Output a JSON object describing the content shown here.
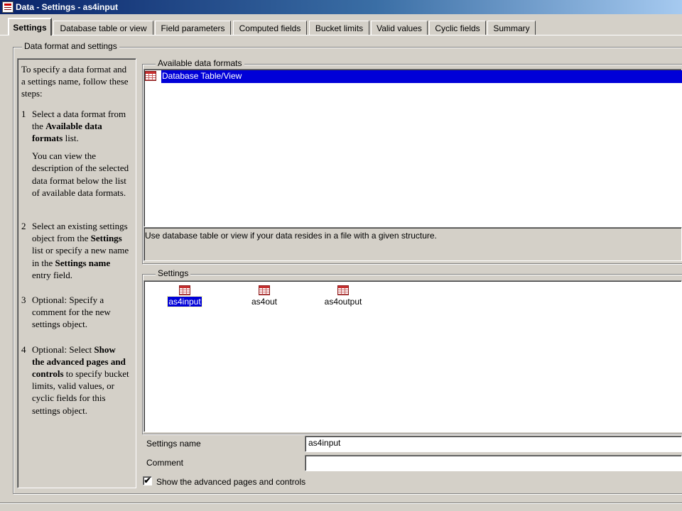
{
  "window": {
    "title": "Data - Settings - as4input"
  },
  "tabs": [
    {
      "label": "Settings",
      "active": true
    },
    {
      "label": "Database table or view"
    },
    {
      "label": "Field parameters"
    },
    {
      "label": "Computed fields"
    },
    {
      "label": "Bucket limits"
    },
    {
      "label": "Valid values"
    },
    {
      "label": "Cyclic fields"
    },
    {
      "label": "Summary"
    }
  ],
  "group": {
    "label": "Data format and settings"
  },
  "help": {
    "intro": "To specify a data format and a settings name, follow these steps:",
    "steps": [
      {
        "num": "1",
        "pre": "Select a data format from the ",
        "bold": "Available data formats",
        "post": " list."
      },
      {
        "sub": "You can view the description of the selected data format below the list of available data formats."
      },
      {
        "num": "2",
        "pre": "Select an existing settings object from the ",
        "bold": "Settings",
        "mid": " list or specify a new name in the ",
        "bold2": "Settings name",
        "post": " entry field."
      },
      {
        "num": "3",
        "pre": "Optional: Specify a comment for the new settings object."
      },
      {
        "num": "4",
        "pre": "Optional: Select ",
        "bold": "Show the advanced pages and controls",
        "post": " to specify bucket limits, valid values, or cyclic fields for this settings object."
      }
    ]
  },
  "formats": {
    "label": "Available data formats",
    "items": [
      {
        "label": "Database Table/View",
        "selected": true,
        "icon": "table-icon"
      }
    ],
    "description": "Use database table or view if your data resides in a file with a given structure."
  },
  "settings": {
    "label": "Settings",
    "items": [
      {
        "label": "as4input",
        "selected": true,
        "icon": "table-icon"
      },
      {
        "label": "as4out",
        "icon": "table-icon"
      },
      {
        "label": "as4output",
        "icon": "table-icon"
      }
    ]
  },
  "fields": {
    "settings_name_label": "Settings name",
    "settings_name_value": "as4input",
    "comment_label": "Comment",
    "comment_value": ""
  },
  "advanced": {
    "label": "Show the advanced pages and controls",
    "checked": true,
    "check_glyph": "✔"
  },
  "colors": {
    "selection": "#0000d8",
    "face": "#d4d0c8"
  }
}
